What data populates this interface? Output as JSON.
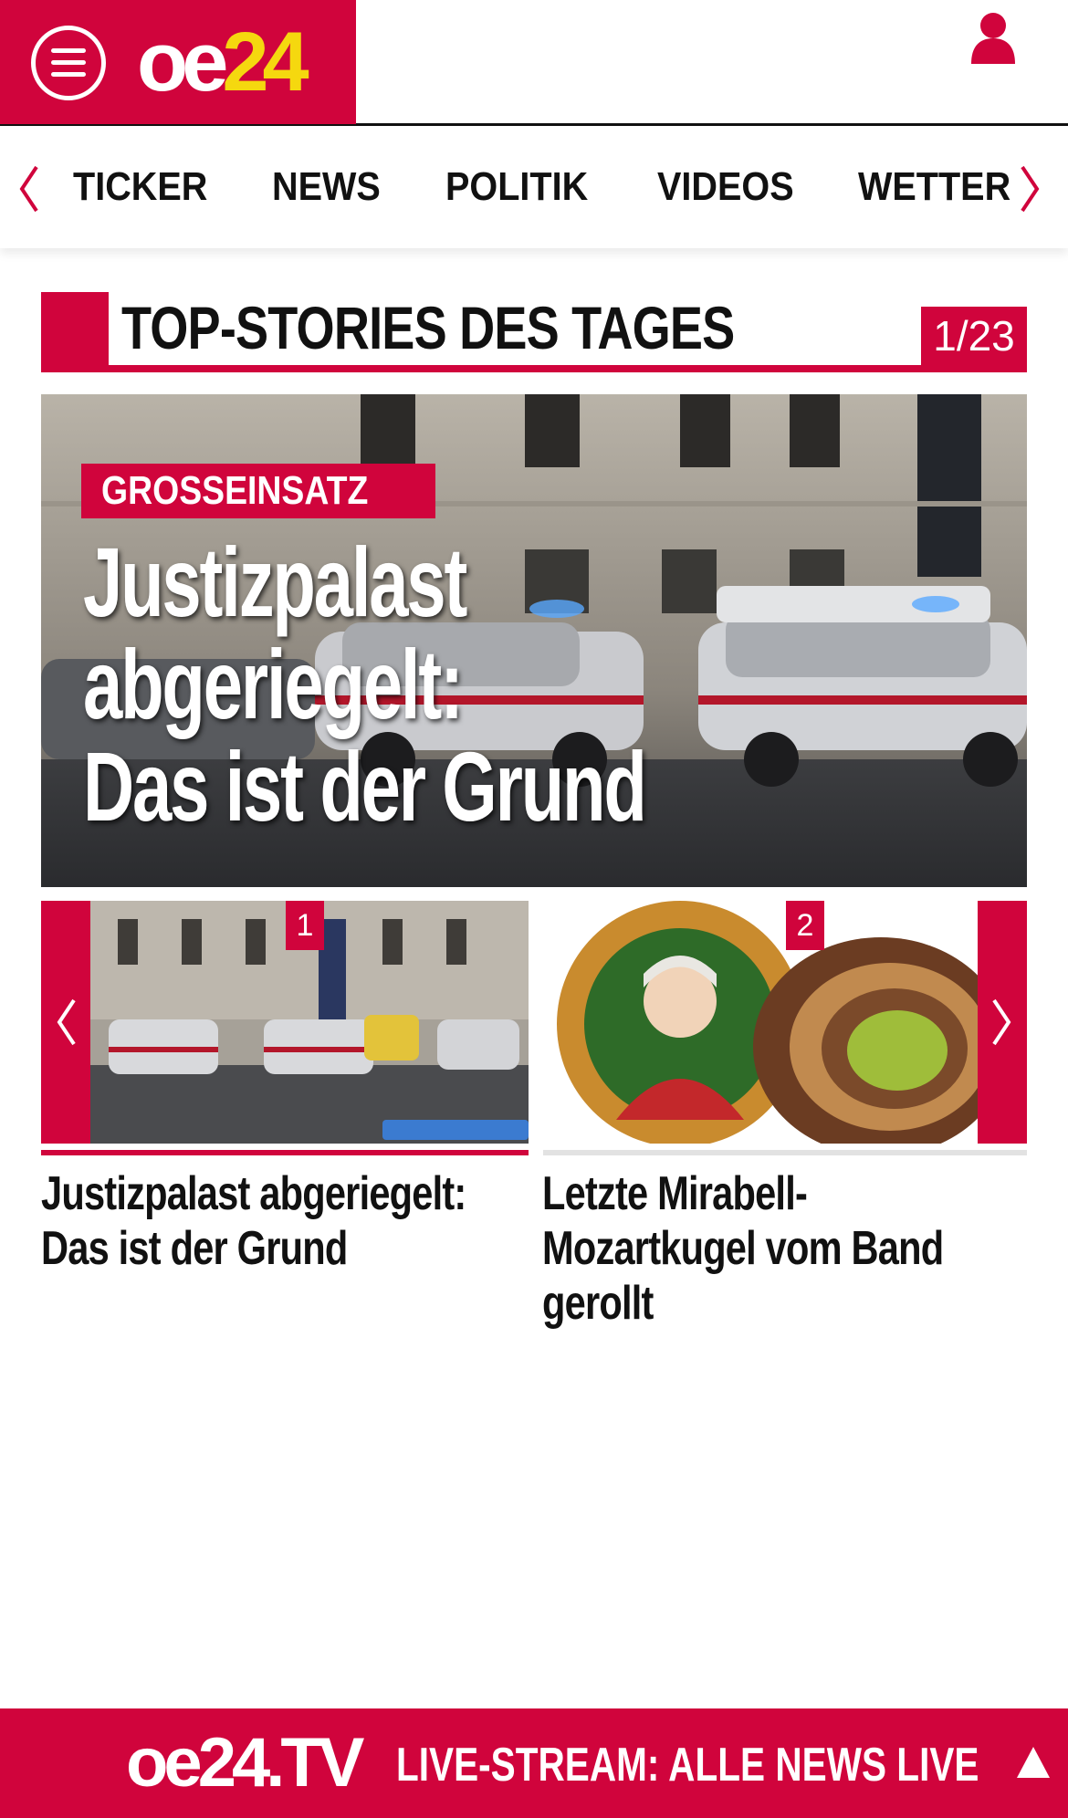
{
  "header": {
    "logo_oe": "oe",
    "logo_num": "24",
    "menu_icon": "hamburger-icon",
    "user_icon": "user-icon",
    "brand_color": "#d0043c",
    "accent_color": "#f5d80f"
  },
  "nav": {
    "items": [
      "TICKER",
      "NEWS",
      "POLITIK",
      "VIDEOS",
      "WETTER"
    ],
    "prev_icon": "chevron-left-icon",
    "next_icon": "chevron-right-icon"
  },
  "section": {
    "title": "TOP-STORIES DES TAGES",
    "counter": "1/23"
  },
  "hero": {
    "kicker": "GROSSEINSATZ",
    "title_lines": [
      "Justizpalast",
      "abgeriegelt:",
      "Das ist der Grund"
    ]
  },
  "carousel": {
    "prev_icon": "chevron-left-icon",
    "next_icon": "chevron-right-icon",
    "items": [
      {
        "rank": "1",
        "headline": "Justizpalast abgeriegelt: Das ist der Grund"
      },
      {
        "rank": "2",
        "headline": "Letzte Mirabell-Mozartkugel vom Band gerollt"
      }
    ]
  },
  "tvbar": {
    "logo": "oe24.TV",
    "text": "LIVE-STREAM:  ALLE NEWS LIVE",
    "up_icon": "arrow-up-icon"
  }
}
